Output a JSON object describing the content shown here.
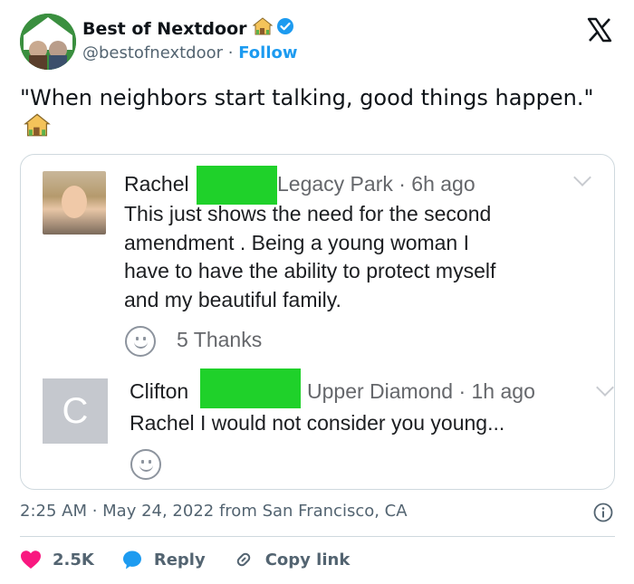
{
  "author": {
    "name": "Best of Nextdoor",
    "handle": "@bestofnextdoor",
    "separator": "·",
    "follow_label": "Follow"
  },
  "tweet": {
    "text": "\"When neighbors start talking, good things happen.\""
  },
  "embedded_post": {
    "comment1": {
      "name": "Rachel",
      "meta": "Legacy Park · 6h ago",
      "body_lines": [
        "This just shows the need for the second",
        "amendment . Being a young woman I",
        "have to have the ability to protect myself",
        "and my beautiful family."
      ],
      "thanks": "5 Thanks"
    },
    "comment2": {
      "avatar_letter": "C",
      "name": "Clifton",
      "meta": "Upper Diamond · 1h ago",
      "body": "Rachel I would not consider you young..."
    },
    "redaction_color": "#1fd12a"
  },
  "footer": {
    "timestamp": "2:25 AM · May 24, 2022 from San Francisco, CA",
    "like_count": "2.5K",
    "reply_label": "Reply",
    "copy_link_label": "Copy link"
  },
  "colors": {
    "accent": "#1d9bf0",
    "like": "#f91880",
    "text": "#0f1419",
    "muted": "#536471"
  },
  "icons": [
    "house-emoji-icon",
    "verified-badge-icon",
    "x-logo-icon",
    "smiley-icon",
    "info-icon",
    "heart-icon",
    "reply-bubble-icon",
    "link-icon",
    "chevron-down-icon"
  ]
}
